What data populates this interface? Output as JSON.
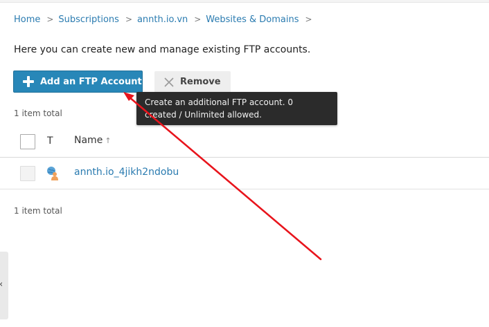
{
  "breadcrumb": {
    "items": [
      {
        "label": "Home"
      },
      {
        "label": "Subscriptions"
      },
      {
        "label": "annth.io.vn"
      },
      {
        "label": "Websites & Domains"
      }
    ],
    "separator": ">"
  },
  "intro_text": "Here you can create new and manage existing FTP accounts.",
  "toolbar": {
    "add_label": "Add an FTP Account",
    "remove_label": "Remove"
  },
  "tooltip": {
    "line1": "Create an additional FTP account. 0",
    "line2": "created / Unlimited allowed."
  },
  "list": {
    "total_top": "1 item total",
    "total_bottom": "1 item total",
    "columns": {
      "type": "T",
      "name": "Name",
      "sort_indicator": "↑"
    },
    "rows": [
      {
        "name": "annth.io_4jikh2ndobu",
        "type_icon": "ftp-user-icon"
      }
    ]
  },
  "side_handle_glyph": "‹",
  "colors": {
    "primary_button": "#2887b8",
    "link": "#2a7bb0",
    "tooltip_bg": "#2b2b2b",
    "annotation_arrow": "#e8141c"
  }
}
